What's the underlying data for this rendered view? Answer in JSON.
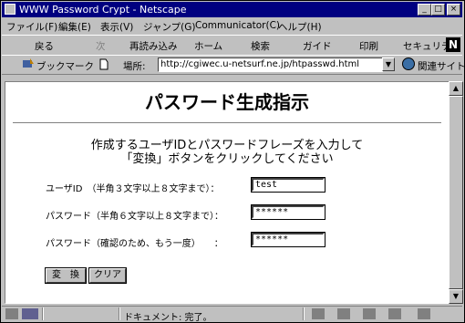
{
  "window": {
    "title": "WWW Password Crypt - Netscape"
  },
  "menu": [
    "ファイル(F)",
    "編集(E)",
    "表示(V)",
    "ジャンプ(G)",
    "Communicator(C)",
    "ヘルプ(H)"
  ],
  "toolbar": {
    "back": "戻る",
    "forward": "次",
    "reload": "再読み込み",
    "home": "ホーム",
    "search": "検索",
    "guide": "ガイド",
    "print": "印刷",
    "security": "セキュリティ",
    "logo": "N"
  },
  "location": {
    "bookmarks": "ブックマーク",
    "label": "場所:",
    "url": "http://cgiwec.u-netsurf.ne.jp/htpasswd.html",
    "related": "関連サイト"
  },
  "page": {
    "heading": "パスワード生成指示",
    "intro_line1": "作成するユーザIDとパスワードフレーズを入力して",
    "intro_line2": "「変換」ボタンをクリックしてください",
    "fields": [
      {
        "label": "ユーザID　（半角３文字以上８文字まで）：",
        "value": "test"
      },
      {
        "label": "パスワード（半角６文字以上８文字まで）：",
        "value": "******"
      },
      {
        "label": "パスワード（確認のため、もう一度）　　：",
        "value": "******"
      }
    ],
    "convert_button": "変　換",
    "clear_button": "クリア"
  },
  "status": {
    "text": "ドキュメント: 完了。"
  }
}
